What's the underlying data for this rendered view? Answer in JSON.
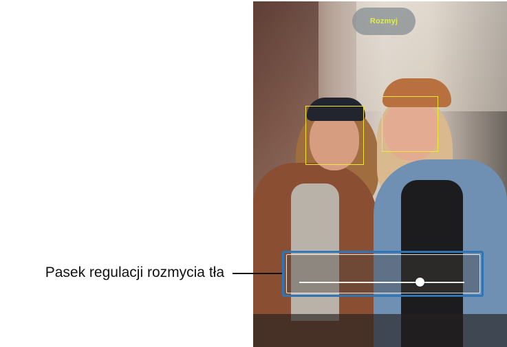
{
  "camera_preview": {
    "mode_button": {
      "label": "Rozmyj"
    },
    "face_frames": 2,
    "background_blur_slider": {
      "value_fraction": 0.73
    }
  },
  "annotation": {
    "label": "Pasek regulacji rozmycia tła"
  },
  "colors": {
    "face_frame": "#f3e53a",
    "highlight_border": "#2f75b5",
    "mode_label": "#e3ee45"
  }
}
